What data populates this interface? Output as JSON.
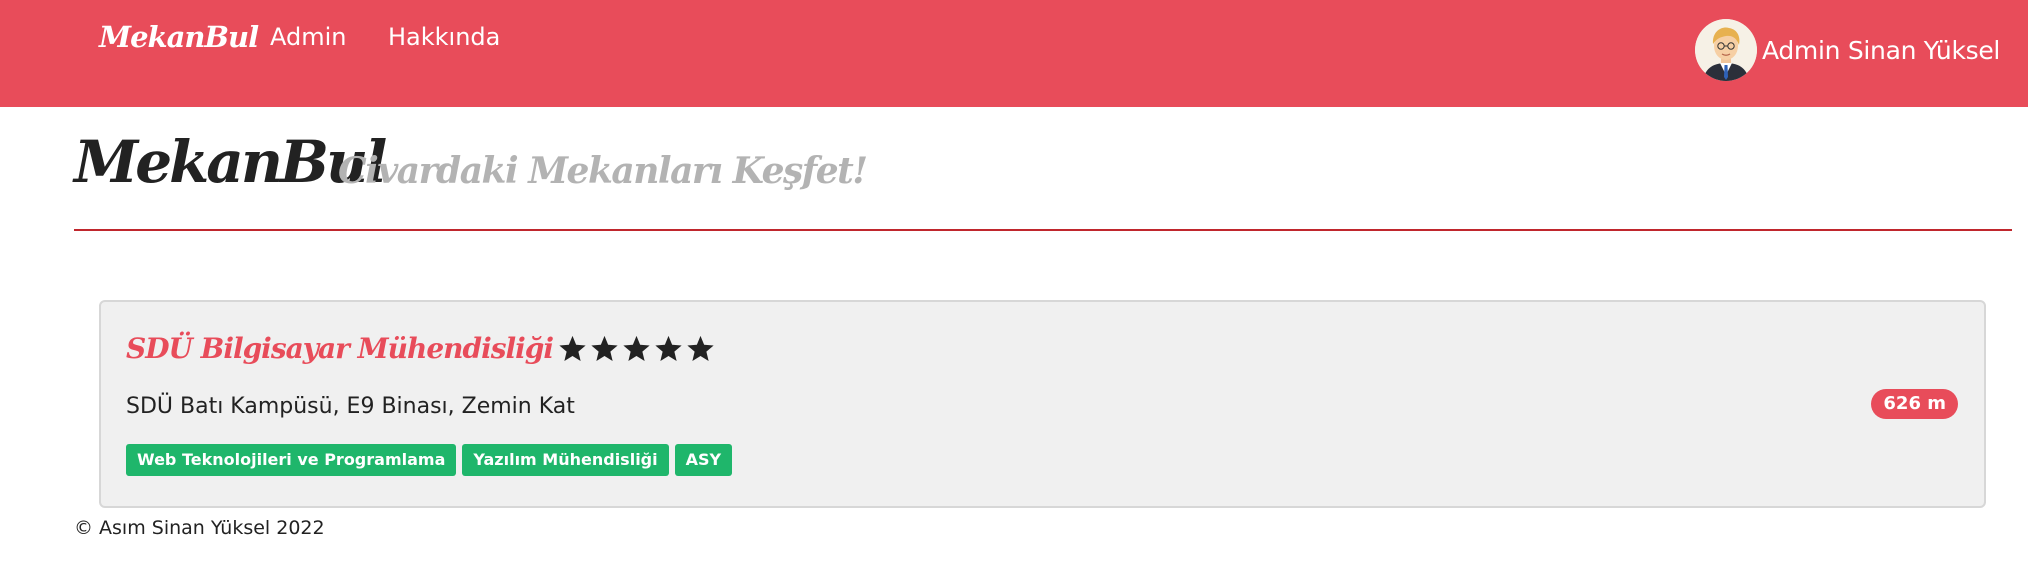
{
  "navbar": {
    "brand": "MekanBul",
    "links": [
      "Admin",
      "Hakkında"
    ],
    "user_name": "Admin Sinan Yüksel",
    "avatar_icon": "user-avatar",
    "color": "#e84c5a"
  },
  "header": {
    "title": "MekanBul",
    "subtitle": "Civardaki Mekanları Keşfet!"
  },
  "places": [
    {
      "name": "SDÜ Bilgisayar Mühendisliği",
      "rating": 5,
      "rating_max": 5,
      "address": "SDÜ Batı Kampüsü, E9 Binası, Zemin Kat",
      "distance": "626 m",
      "facilities": [
        "Web Teknolojileri ve Programlama",
        "Yazılım Mühendisliği",
        "ASY"
      ]
    }
  ],
  "footer": {
    "text": "© Asım Sinan Yüksel 2022"
  },
  "colors": {
    "accent": "#e84c5a",
    "tag": "#1fb66b",
    "rule": "#c0272d"
  }
}
